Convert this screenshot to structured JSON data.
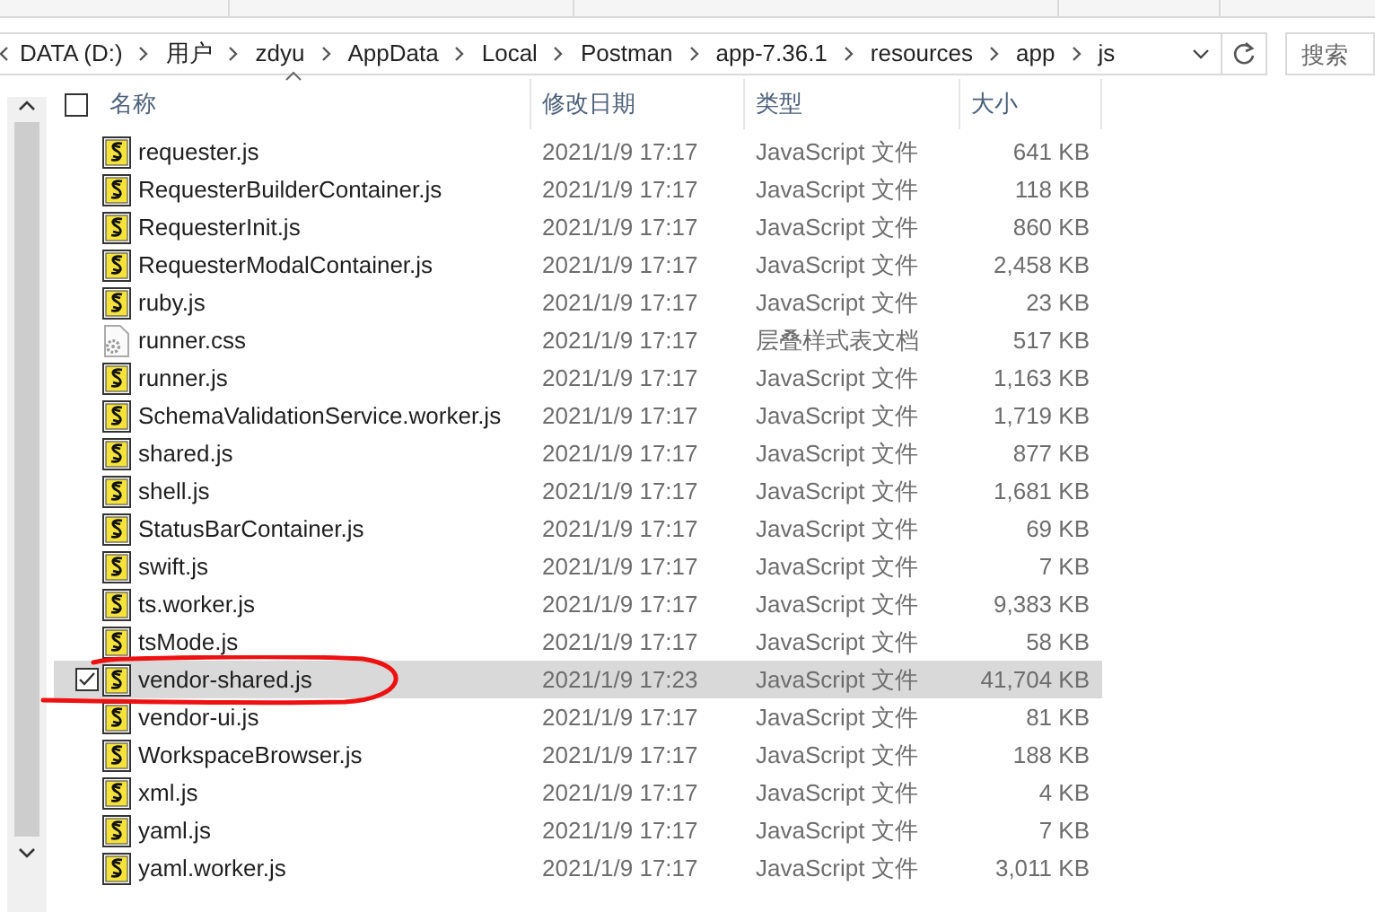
{
  "address_bar": {
    "path": [
      "DATA (D:)",
      "用户",
      "zdyu",
      "AppData",
      "Local",
      "Postman",
      "app-7.36.1",
      "resources",
      "app",
      "js"
    ]
  },
  "search": {
    "placeholder": "搜索"
  },
  "table": {
    "select_all": {
      "checked": false
    },
    "columns": [
      "名称",
      "修改日期",
      "类型",
      "大小"
    ],
    "rows": [
      {
        "name": "requester.js",
        "modified": "2021/1/9 17:17",
        "type": "JavaScript 文件",
        "size": "641 KB",
        "kind": "js",
        "selected": false
      },
      {
        "name": "RequesterBuilderContainer.js",
        "modified": "2021/1/9 17:17",
        "type": "JavaScript 文件",
        "size": "118 KB",
        "kind": "js",
        "selected": false
      },
      {
        "name": "RequesterInit.js",
        "modified": "2021/1/9 17:17",
        "type": "JavaScript 文件",
        "size": "860 KB",
        "kind": "js",
        "selected": false
      },
      {
        "name": "RequesterModalContainer.js",
        "modified": "2021/1/9 17:17",
        "type": "JavaScript 文件",
        "size": "2,458 KB",
        "kind": "js",
        "selected": false
      },
      {
        "name": "ruby.js",
        "modified": "2021/1/9 17:17",
        "type": "JavaScript 文件",
        "size": "23 KB",
        "kind": "js",
        "selected": false
      },
      {
        "name": "runner.css",
        "modified": "2021/1/9 17:17",
        "type": "层叠样式表文档",
        "size": "517 KB",
        "kind": "css",
        "selected": false
      },
      {
        "name": "runner.js",
        "modified": "2021/1/9 17:17",
        "type": "JavaScript 文件",
        "size": "1,163 KB",
        "kind": "js",
        "selected": false
      },
      {
        "name": "SchemaValidationService.worker.js",
        "modified": "2021/1/9 17:17",
        "type": "JavaScript 文件",
        "size": "1,719 KB",
        "kind": "js",
        "selected": false
      },
      {
        "name": "shared.js",
        "modified": "2021/1/9 17:17",
        "type": "JavaScript 文件",
        "size": "877 KB",
        "kind": "js",
        "selected": false
      },
      {
        "name": "shell.js",
        "modified": "2021/1/9 17:17",
        "type": "JavaScript 文件",
        "size": "1,681 KB",
        "kind": "js",
        "selected": false
      },
      {
        "name": "StatusBarContainer.js",
        "modified": "2021/1/9 17:17",
        "type": "JavaScript 文件",
        "size": "69 KB",
        "kind": "js",
        "selected": false
      },
      {
        "name": "swift.js",
        "modified": "2021/1/9 17:17",
        "type": "JavaScript 文件",
        "size": "7 KB",
        "kind": "js",
        "selected": false
      },
      {
        "name": "ts.worker.js",
        "modified": "2021/1/9 17:17",
        "type": "JavaScript 文件",
        "size": "9,383 KB",
        "kind": "js",
        "selected": false
      },
      {
        "name": "tsMode.js",
        "modified": "2021/1/9 17:17",
        "type": "JavaScript 文件",
        "size": "58 KB",
        "kind": "js",
        "selected": false
      },
      {
        "name": "vendor-shared.js",
        "modified": "2021/1/9 17:23",
        "type": "JavaScript 文件",
        "size": "41,704 KB",
        "kind": "js",
        "selected": true
      },
      {
        "name": "vendor-ui.js",
        "modified": "2021/1/9 17:17",
        "type": "JavaScript 文件",
        "size": "81 KB",
        "kind": "js",
        "selected": false
      },
      {
        "name": "WorkspaceBrowser.js",
        "modified": "2021/1/9 17:17",
        "type": "JavaScript 文件",
        "size": "188 KB",
        "kind": "js",
        "selected": false
      },
      {
        "name": "xml.js",
        "modified": "2021/1/9 17:17",
        "type": "JavaScript 文件",
        "size": "4 KB",
        "kind": "js",
        "selected": false
      },
      {
        "name": "yaml.js",
        "modified": "2021/1/9 17:17",
        "type": "JavaScript 文件",
        "size": "7 KB",
        "kind": "js",
        "selected": false
      },
      {
        "name": "yaml.worker.js",
        "modified": "2021/1/9 17:17",
        "type": "JavaScript 文件",
        "size": "3,011 KB",
        "kind": "js",
        "selected": false
      }
    ]
  }
}
